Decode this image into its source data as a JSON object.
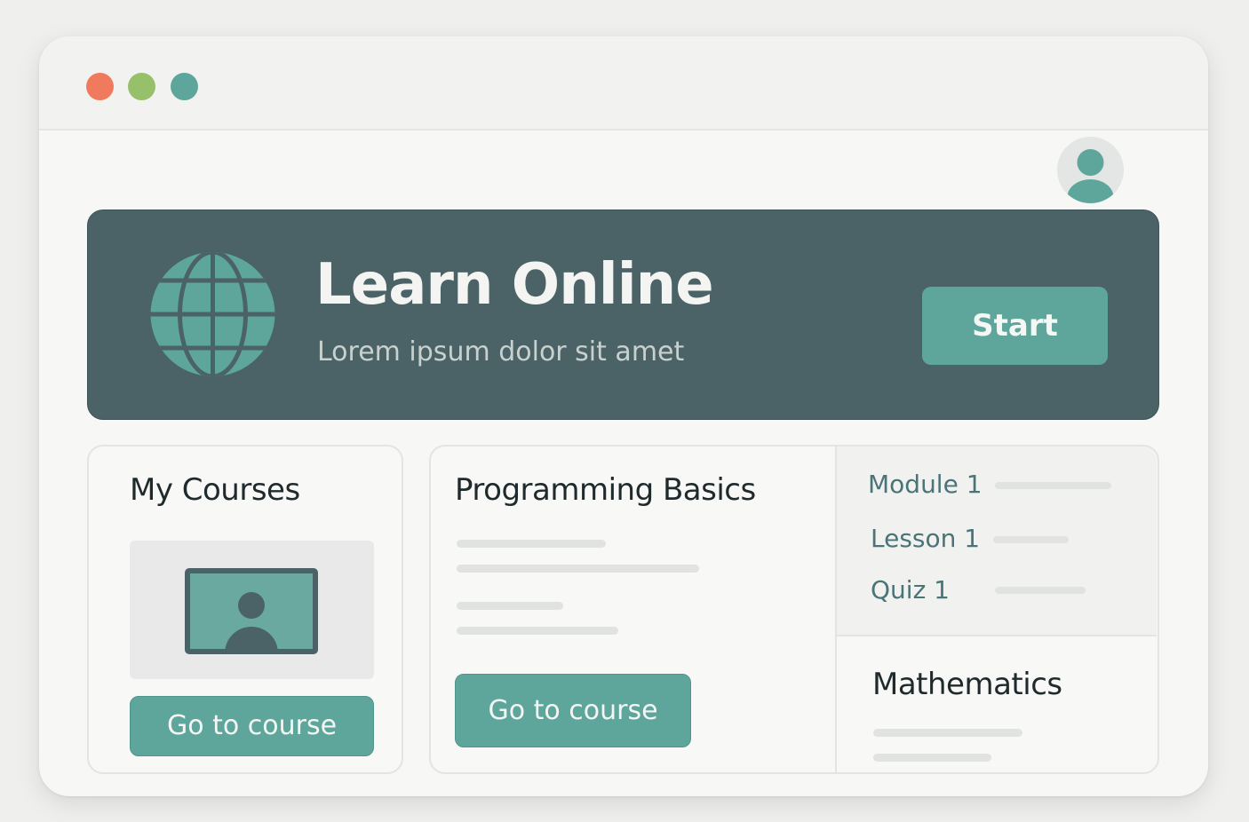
{
  "window": {
    "controls": [
      {
        "name": "close",
        "color": "#f07a5e"
      },
      {
        "name": "minimize",
        "color": "#97c06a"
      },
      {
        "name": "maximize",
        "color": "#5ea69c"
      }
    ]
  },
  "header": {
    "avatar_icon": "user-avatar-icon"
  },
  "hero": {
    "icon": "globe-icon",
    "title": "Learn Online",
    "subtitle": "Lorem ipsum dolor sit amet",
    "start_label": "Start"
  },
  "my_courses": {
    "title": "My Courses",
    "thumbnail_icon": "video-lesson-icon",
    "button_label": "Go to course"
  },
  "programming": {
    "title": "Programming Basics",
    "button_label": "Go to course"
  },
  "course_outline": {
    "items": [
      {
        "label": "Module 1"
      },
      {
        "label": "Lesson 1"
      },
      {
        "label": "Quiz 1"
      }
    ]
  },
  "mathematics": {
    "title": "Mathematics"
  },
  "colors": {
    "accent": "#5ea69c",
    "hero_bg": "#4b6366",
    "text_dark": "#1f2a2d",
    "outline_text": "#4b7478"
  }
}
